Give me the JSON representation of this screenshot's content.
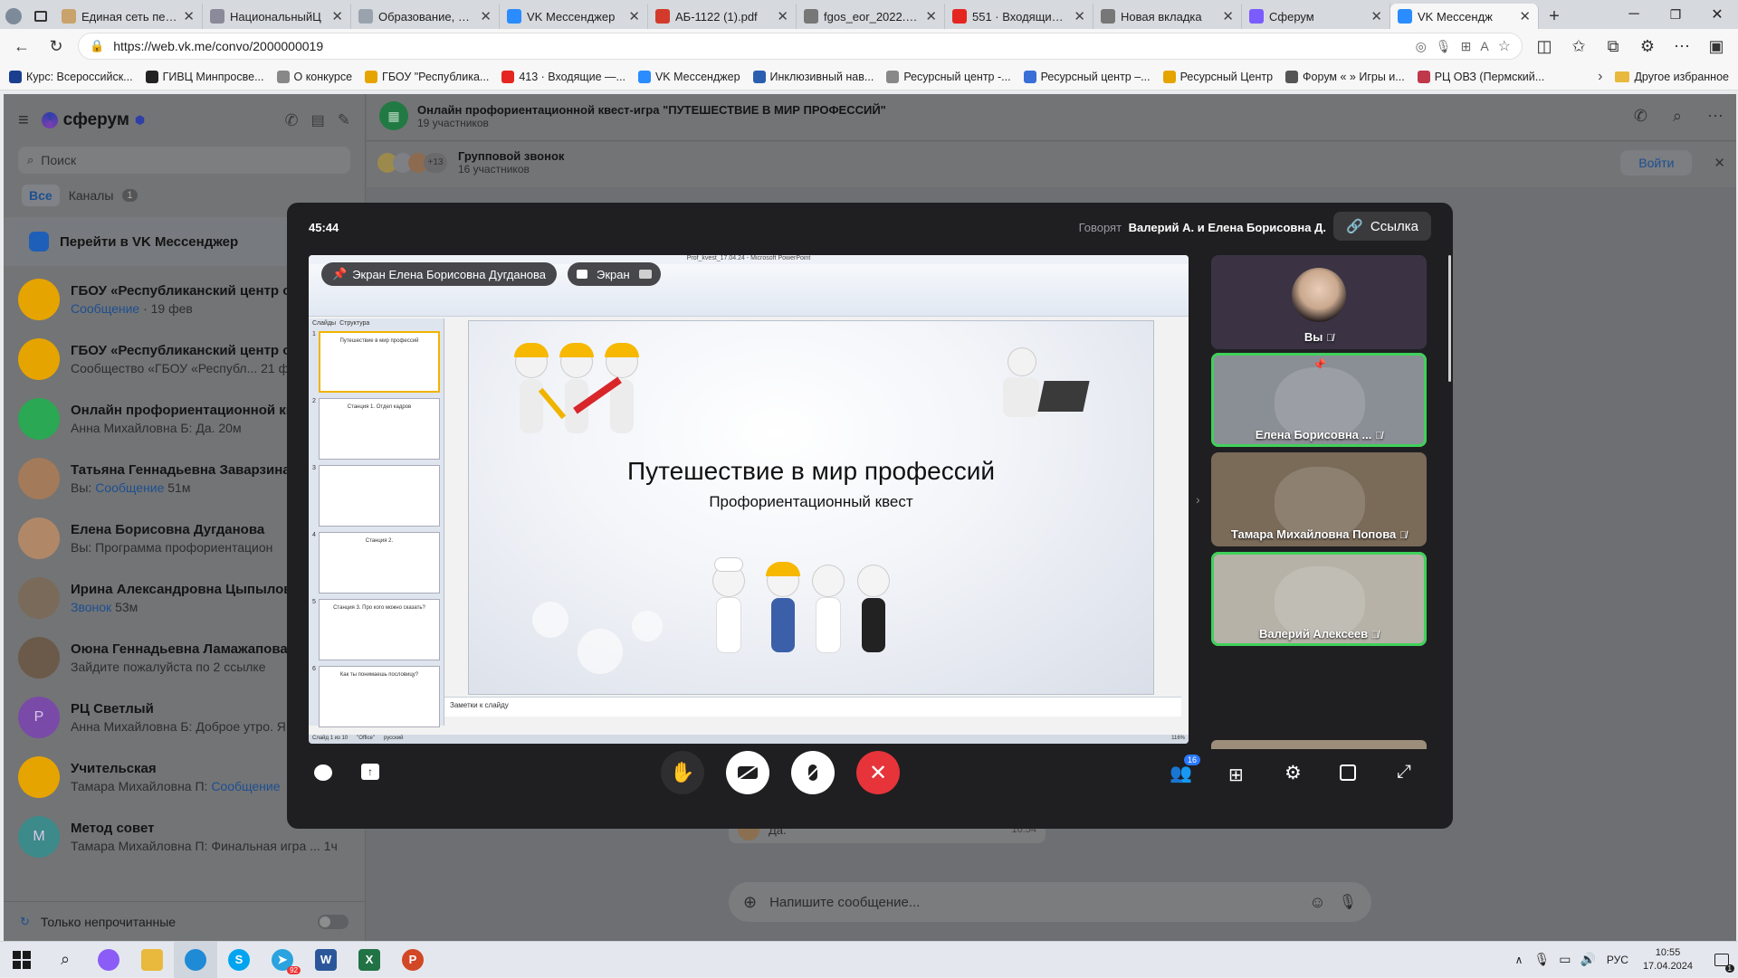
{
  "browser": {
    "tabs": [
      {
        "label": "Единая сеть пере",
        "color": "#c9a36b"
      },
      {
        "label": "НациональныйЦ",
        "color": "#8a8a9a"
      },
      {
        "label": "Образование, тру",
        "color": "#9aa3ad"
      },
      {
        "label": "VK Мессенджер",
        "color": "#2a8cff"
      },
      {
        "label": "АБ-1122 (1).pdf",
        "color": "#d23b2b"
      },
      {
        "label": "fgos_eor_2022.pdf",
        "color": "#777777"
      },
      {
        "label": "551 · Входящие —",
        "color": "#e52620"
      },
      {
        "label": "Новая вкладка",
        "color": "#777777"
      },
      {
        "label": "Сферум",
        "color": "#7b5cff"
      },
      {
        "label": "VK Мессендж",
        "color": "#2a8cff"
      }
    ],
    "url": "https://web.vk.me/convo/2000000019",
    "bookmarks": [
      {
        "label": "Курс: Всероссийск...",
        "color": "#1a3f8f"
      },
      {
        "label": "ГИВЦ Минпросве...",
        "color": "#222222"
      },
      {
        "label": "О конкурсе",
        "color": "#888888"
      },
      {
        "label": "ГБОУ \"Республика...",
        "color": "#e6a400"
      },
      {
        "label": "413 · Входящие —...",
        "color": "#e52620"
      },
      {
        "label": "VK Мессенджер",
        "color": "#2a8cff"
      },
      {
        "label": "Инклюзивный нав...",
        "color": "#2a5fb0"
      },
      {
        "label": "Ресурсный центр -...",
        "color": "#888888"
      },
      {
        "label": "Ресурсный центр –...",
        "color": "#3a6fd8"
      },
      {
        "label": "Ресурсный Центр",
        "color": "#e6a400"
      },
      {
        "label": "Форум « » Игры и...",
        "color": "#555555"
      },
      {
        "label": "РЦ ОВЗ (Пермский...",
        "color": "#c0394b"
      }
    ],
    "other_bookmarks": "Другое избранное"
  },
  "sidebar": {
    "app_name": "сферум",
    "search_placeholder": "Поиск",
    "filters": {
      "all": "Все",
      "channels": "Каналы",
      "channels_count": "1"
    },
    "vk_link": "Перейти в VK Мессенджер",
    "chats": [
      {
        "name": "ГБОУ «Республиканский центр о",
        "msg": "Сообщение",
        "time": "· 19 фев",
        "color": "#e6a400",
        "link": true,
        "initial": ""
      },
      {
        "name": "ГБОУ «Республиканский центр о",
        "msg": "Сообщество «ГБОУ «Республ...",
        "time": "21 ф",
        "color": "#e6a400",
        "link": false,
        "initial": ""
      },
      {
        "name": "Онлайн профориентационной кв",
        "msg": "Анна Михайловна Б: Да.",
        "time": "20м",
        "color": "#2aa853",
        "link": false,
        "initial": ""
      },
      {
        "name": "Татьяна Геннадьевна Заварзина",
        "msg": "Сообщение",
        "prefix": "Вы: ",
        "time": "51м",
        "color": "#a37a5a",
        "link": true,
        "initial": ""
      },
      {
        "name": "Елена Борисовна Дугданова",
        "msg": "Вы: Программа профориентацион",
        "time": "",
        "color": "#b08868",
        "link": false,
        "initial": ""
      },
      {
        "name": "Ирина Александровна Цыпылов",
        "msg": "Звонок",
        "time": "53м",
        "color": "#7a6a5a",
        "link": true,
        "initial": ""
      },
      {
        "name": "Оюна Геннадьевна Ламажапова",
        "msg": "Зайдите пожалуйста по 2 ссылке",
        "time": "",
        "color": "#6b5a4a",
        "link": false,
        "initial": ""
      },
      {
        "name": "РЦ Светлый",
        "msg": "Анна Михайловна Б: Доброе утро. Я",
        "time": "",
        "color": "#7a4aa8",
        "link": false,
        "initial": "Р"
      },
      {
        "name": "Учительская",
        "msg": "Сообщение",
        "prefix": "Тамара Михайловна П: ",
        "time": "",
        "color": "#e6a400",
        "link": true,
        "initial": ""
      },
      {
        "name": "Метод совет",
        "msg": "Тамара Михайловна П: Финальная игра ...",
        "time": "1ч",
        "color": "#3c8a8a",
        "link": false,
        "initial": "М"
      }
    ],
    "unread_only": "Только непрочитанные"
  },
  "chat": {
    "title": "Онлайн профориентационной квест-игра \"ПУТЕШЕСТВИЕ В МИР ПРОФЕССИЙ\"",
    "members": "19 участников",
    "group_call": "Групповой звонок",
    "group_call_members": "16 участников",
    "group_call_extra": "+13",
    "join": "Войти",
    "bg_msg": "Да.",
    "bg_time": "10:54",
    "composer_placeholder": "Напишите сообщение..."
  },
  "call": {
    "timer": "45:44",
    "speaking_label": "Говорят",
    "speaking_names": "Валерий А. и Елена Борисовна Д.",
    "link_button": "Ссылка",
    "screen_owner": "Экран Елена Борисовна Дугданова",
    "screen_toggle": "Экран",
    "participants_count": "16",
    "participants": [
      {
        "name": "Вы",
        "bg": "#3b3344"
      },
      {
        "name": "Елена Борисовна ...",
        "bg": "#8a8e95",
        "speaking": true,
        "pinned": true
      },
      {
        "name": "Тамара Михайловна Попова",
        "bg": "#7a6a58"
      },
      {
        "name": "Валерий Алексеев",
        "bg": "#b6b2a8",
        "speaking": true
      }
    ]
  },
  "slide": {
    "window_title": "Prof_kvest_17.04.24 - Microsoft PowerPoint",
    "title": "Путешествие в мир профессий",
    "subtitle": "Профориентационный квест",
    "notes": "Заметки к слайду",
    "panel_tabs": [
      "Слайды",
      "Структура"
    ],
    "thumbs": [
      "1",
      "2",
      "3",
      "4",
      "5",
      "6"
    ],
    "thumb_texts": [
      "Путешествие в мир профессий",
      "Станция 1. Отдел кадров",
      "",
      "Станция 2.",
      "Станция 3. Про кого можно сказать?",
      "Как ты понимаешь пословицу?"
    ],
    "status_left": "Слайд 1 из 10",
    "status_theme": "\"Office\"",
    "status_lang": "русский",
    "zoom": "116%"
  },
  "taskbar": {
    "lang": "РУС",
    "time": "10:55",
    "date": "17.04.2024",
    "telegram_badge": "92",
    "notif_count": "1"
  }
}
